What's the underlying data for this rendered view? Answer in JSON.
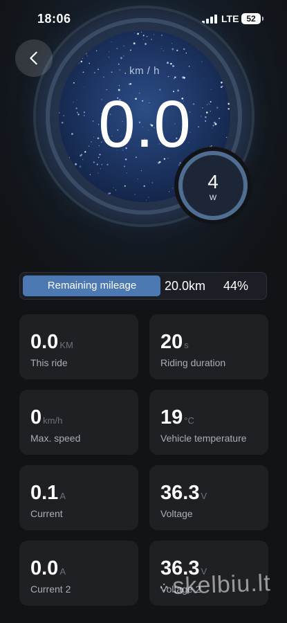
{
  "status_bar": {
    "time": "18:06",
    "network": "LTE",
    "battery": "52"
  },
  "gauge": {
    "speed_unit": "km / h",
    "speed": "0.0",
    "power_value": "4",
    "power_unit": "W"
  },
  "remaining": {
    "label": "Remaining mileage",
    "distance": "20.0km",
    "percent_text": "44%",
    "percent": 44
  },
  "stats": [
    {
      "value": "0.0",
      "unit": "KM",
      "label": "This ride"
    },
    {
      "value": "20",
      "unit": "s",
      "label": "Riding duration"
    },
    {
      "value": "0",
      "unit": "km/h",
      "label": "Max. speed"
    },
    {
      "value": "19",
      "unit": "°C",
      "label": "Vehicle temperature"
    },
    {
      "value": "0.1",
      "unit": "A",
      "label": "Current"
    },
    {
      "value": "36.3",
      "unit": "V",
      "label": "Voltage"
    },
    {
      "value": "0.0",
      "unit": "A",
      "label": "Current 2"
    },
    {
      "value": "36.3",
      "unit": "V",
      "label": "Voltage 2"
    }
  ],
  "watermark": "skelbiu.lt",
  "icons": {
    "back": "chevron-left-icon",
    "signal": "signal-icon",
    "battery": "battery-icon"
  },
  "colors": {
    "accent": "#4d79b2",
    "background": "#111317",
    "card": "#1f2024"
  }
}
